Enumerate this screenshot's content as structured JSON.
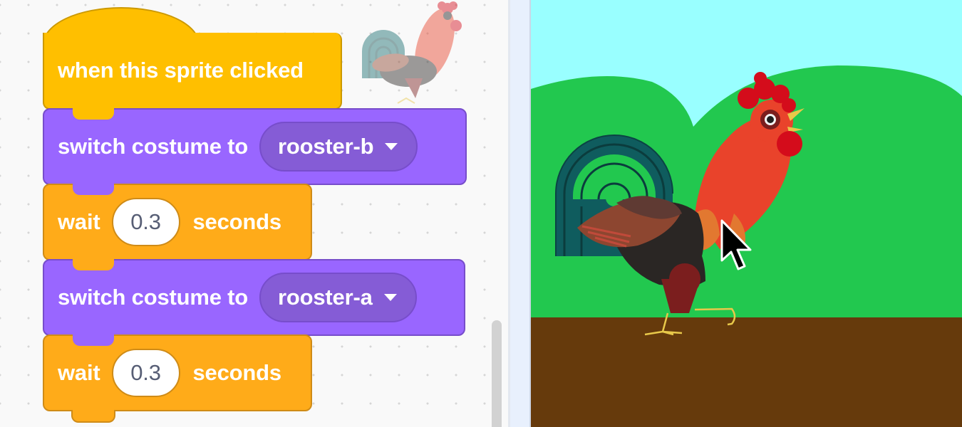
{
  "code_area": {
    "hat_block": {
      "label": "when this sprite clicked"
    },
    "blocks": [
      {
        "type": "looks",
        "label": "switch costume to",
        "dropdown_value": "rooster-b"
      },
      {
        "type": "control",
        "label": "wait",
        "input_value": "0.3",
        "suffix": "seconds"
      },
      {
        "type": "looks",
        "label": "switch costume to",
        "dropdown_value": "rooster-a"
      },
      {
        "type": "control",
        "label": "wait",
        "input_value": "0.3",
        "suffix": "seconds"
      }
    ]
  },
  "sprite": {
    "name": "rooster-icon"
  },
  "stage": {
    "sky_color": "#99ffff",
    "hill_color": "#22c84f",
    "ground_color": "#663a0c"
  },
  "colors": {
    "events": "#ffbf00",
    "looks": "#9966ff",
    "control": "#ffab19"
  }
}
